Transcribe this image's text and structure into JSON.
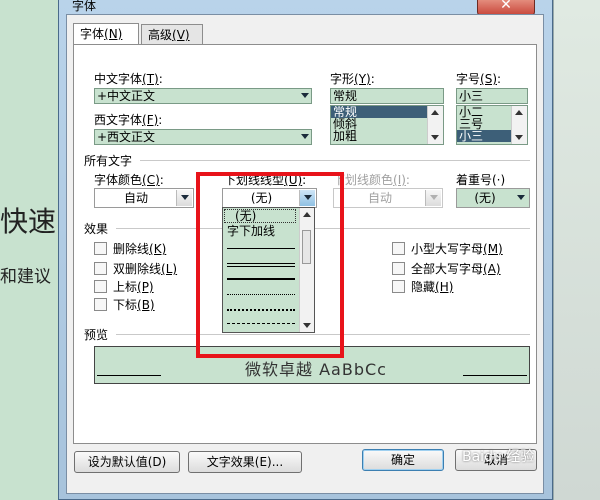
{
  "dialog": {
    "title": "字体",
    "close_glyph": "✕",
    "tabs": [
      {
        "label": "字体",
        "key": "(N)"
      },
      {
        "label": "高级",
        "key": "(V)"
      }
    ]
  },
  "font": {
    "chinese_font_label": "中文字体",
    "chinese_font_key": "(T)",
    "chinese_font_value": "+中文正文",
    "western_font_label": "西文字体",
    "western_font_key": "(F)",
    "western_font_value": "+西文正文",
    "style_label": "字形",
    "style_key": "(Y)",
    "style_value": "常规",
    "style_options": [
      "常规",
      "倾斜",
      "加粗"
    ],
    "size_label": "字号",
    "size_key": "(S)",
    "size_value": "小三",
    "size_options": [
      "小二",
      "三号",
      "小三"
    ]
  },
  "all_text": {
    "section_label": "所有文字",
    "color_label": "字体颜色",
    "color_key": "(C)",
    "color_value": "自动",
    "underline_label": "下划线线型",
    "underline_key": "(U)",
    "underline_value": "(无)",
    "underline_color_label": "下划线颜色",
    "underline_color_key": "(I)",
    "underline_color_value": "自动",
    "emphasis_label": "着重号(·)",
    "emphasis_value": "(无)"
  },
  "underline_dropdown": {
    "items": [
      "(无)",
      "字下加线"
    ]
  },
  "effects": {
    "section_label": "效果",
    "left": [
      {
        "label": "删除线",
        "key": "(K)"
      },
      {
        "label": "双删除线",
        "key": "(L)"
      },
      {
        "label": "上标",
        "key": "(P)"
      },
      {
        "label": "下标",
        "key": "(B)"
      }
    ],
    "right": [
      {
        "label": "小型大写字母",
        "key": "(M)"
      },
      {
        "label": "全部大写字母",
        "key": "(A)"
      },
      {
        "label": "隐藏",
        "key": "(H)"
      }
    ]
  },
  "preview": {
    "section_label": "预览",
    "text": "微软卓越  AaBbCc"
  },
  "buttons": {
    "set_default": "设为默认值(D)",
    "text_effects": "文字效果(E)...",
    "ok": "确定",
    "cancel": "取消"
  },
  "background_doc": {
    "line1": "快速",
    "line2": "和建议"
  },
  "watermark": "Baidu 经验",
  "colors": {
    "field_bg": "#c8e2cf",
    "highlight": "#e8131a",
    "selection": "#3d5f78"
  }
}
